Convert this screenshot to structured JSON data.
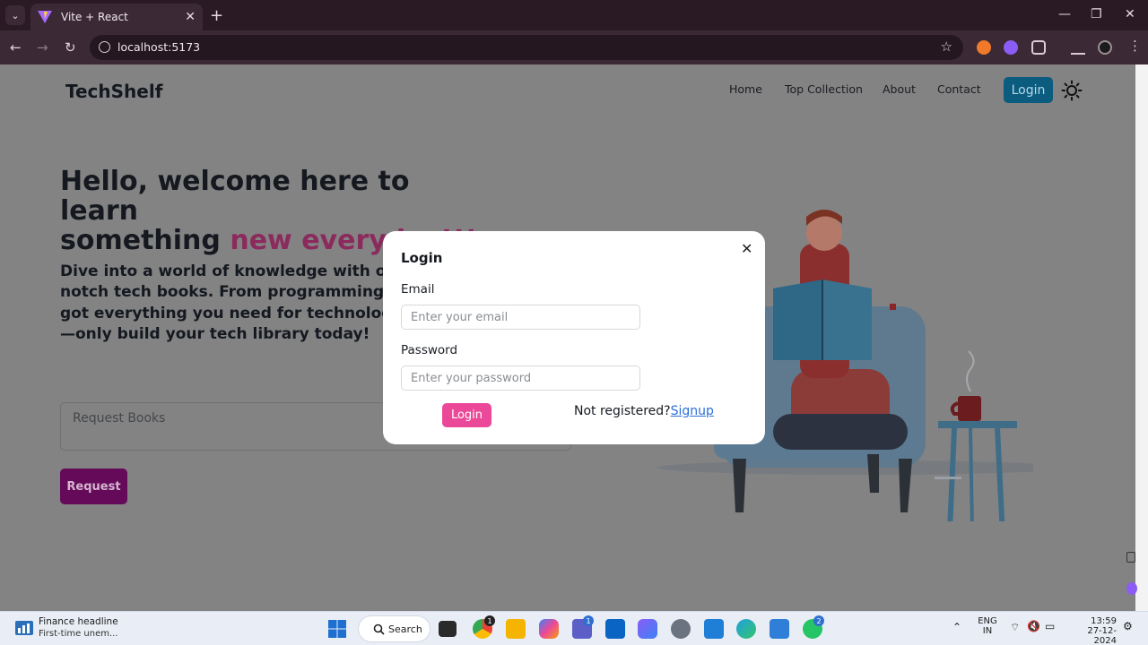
{
  "browser": {
    "tab_title": "Vite + React",
    "url": "localhost:5173"
  },
  "navbar": {
    "brand": "TechShelf",
    "links": [
      "Home",
      "Top Collection",
      "About",
      "Contact"
    ],
    "login_label": "Login"
  },
  "hero": {
    "title_line1": "Hello, welcome here to learn",
    "title_line2_plain": "something ",
    "title_line2_accent": "new everyday!!!",
    "body": "Dive into a world of knowledge with our curated collection of top-notch tech books. From programming and cybersecurity, we’ve got everything you need for technology. Explore, learn, and grow—only build your tech library today!",
    "request_placeholder": "Request Books",
    "request_button": "Request"
  },
  "modal": {
    "title": "Login",
    "email_label": "Email",
    "email_placeholder": "Enter your email",
    "password_label": "Password",
    "password_placeholder": "Enter your password",
    "login_button": "Login",
    "not_registered": "Not registered?",
    "signup_link": "Signup"
  },
  "taskbar": {
    "widget_title": "Finance headline",
    "widget_subtitle": "First-time unem...",
    "search_label": "Search",
    "chrome_badge": "1",
    "teams_badge": "1",
    "whatsapp_badge": "2",
    "lang_line1": "ENG",
    "lang_line2": "IN",
    "time": "13:59",
    "date": "27-12-2024"
  },
  "colors": {
    "accent_pink": "#ec4899",
    "nav_login_bg": "#0b5c7f",
    "request_bg": "#640a59"
  }
}
